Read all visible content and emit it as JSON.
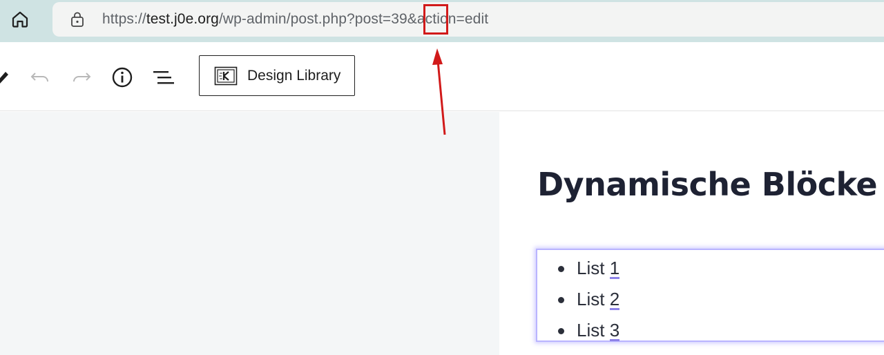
{
  "browser": {
    "home_icon": "home-icon",
    "lock_icon": "lock-icon",
    "url_scheme": "https://",
    "url_host": "test.j0e.org",
    "url_path": "/wp-admin/post.php?post=39&action=edit"
  },
  "toolbar": {
    "tools": [
      "pencil-icon",
      "undo-icon",
      "redo-icon",
      "info-icon",
      "list-view-icon"
    ],
    "design_library_label": "Design Library",
    "design_library_icon": "kadence-library-icon"
  },
  "editor": {
    "post_title": "Dynamische Blöcke",
    "list_items": [
      {
        "prefix": "List ",
        "number": "1"
      },
      {
        "prefix": "List ",
        "number": "2"
      },
      {
        "prefix": "List ",
        "number": "3"
      }
    ]
  },
  "colors": {
    "annotation": "#d11a1a",
    "block_outline": "#b9b4ff",
    "link_underline": "#8d82e8"
  }
}
